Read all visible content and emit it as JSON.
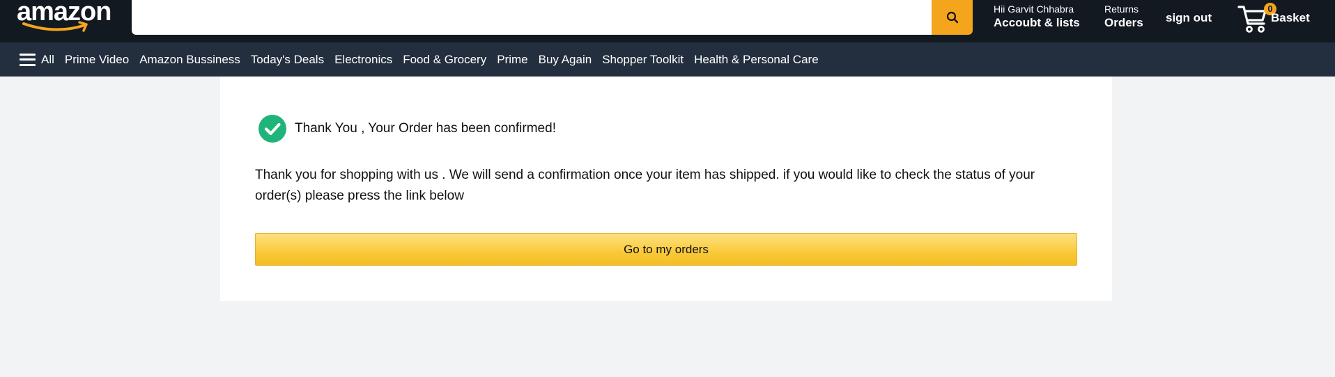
{
  "header": {
    "logo_text": "amazon",
    "search": {
      "value": "",
      "placeholder": ""
    },
    "account": {
      "greeting": "Hii Garvit Chhabra",
      "label": "Accoubt & lists"
    },
    "orders": {
      "line1": "Returns",
      "line2": "Orders"
    },
    "signout_label": "sign out",
    "basket": {
      "count": "0",
      "label": "Basket"
    },
    "colors": {
      "background": "#131921",
      "accent": "#f4a51c"
    }
  },
  "nav": {
    "all_label": "All",
    "items": [
      {
        "label": "Prime Video"
      },
      {
        "label": "Amazon Bussiness"
      },
      {
        "label": "Today's Deals"
      },
      {
        "label": "Electronics"
      },
      {
        "label": "Food & Grocery"
      },
      {
        "label": "Prime"
      },
      {
        "label": "Buy Again"
      },
      {
        "label": "Shopper Toolkit"
      },
      {
        "label": "Health & Personal Care"
      }
    ],
    "background": "#232f3e"
  },
  "confirmation": {
    "icon": "check-circle-icon",
    "icon_color": "#1fb57a",
    "title": "Thank You , Your Order has been confirmed!",
    "message": "Thank you for shopping with us . We will send a confirmation once your item has shipped. if you would like to check the status of your order(s) please press the link below",
    "button_label": "Go to my orders"
  },
  "icons": {
    "search": "search-icon",
    "cart": "cart-icon",
    "menu": "hamburger-menu-icon"
  }
}
